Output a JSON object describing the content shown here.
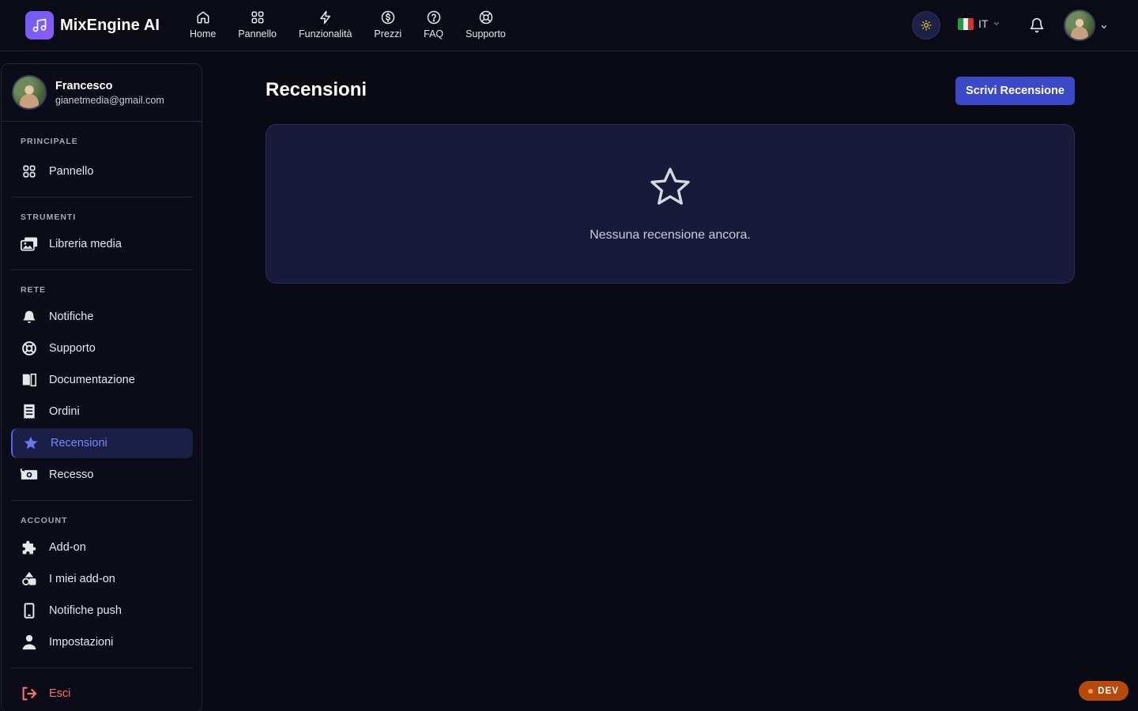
{
  "brand": {
    "name": "MixEngine AI",
    "icon": "music-note-icon",
    "accent": "#6d5cf6"
  },
  "nav": {
    "items": [
      {
        "label": "Home",
        "icon": "home-icon"
      },
      {
        "label": "Pannello",
        "icon": "grid-icon"
      },
      {
        "label": "Funzionalità",
        "icon": "bolt-icon"
      },
      {
        "label": "Prezzi",
        "icon": "dollar-icon"
      },
      {
        "label": "FAQ",
        "icon": "question-icon"
      },
      {
        "label": "Supporto",
        "icon": "lifebuoy-icon"
      }
    ]
  },
  "header": {
    "language": "IT",
    "theme_icon": "sun-icon",
    "notifications_icon": "bell-icon"
  },
  "profile": {
    "name": "Francesco",
    "email": "gianetmedia@gmail.com"
  },
  "sidebar": {
    "sections": [
      {
        "title": "PRINCIPALE",
        "items": [
          {
            "label": "Pannello",
            "icon": "grid-icon"
          }
        ]
      },
      {
        "title": "STRUMENTI",
        "items": [
          {
            "label": "Libreria media",
            "icon": "photos-icon"
          }
        ]
      },
      {
        "title": "RETE",
        "items": [
          {
            "label": "Notifiche",
            "icon": "bell-icon"
          },
          {
            "label": "Supporto",
            "icon": "lifebuoy-icon"
          },
          {
            "label": "Documentazione",
            "icon": "book-icon"
          },
          {
            "label": "Ordini",
            "icon": "receipt-icon"
          },
          {
            "label": "Recensioni",
            "icon": "star-icon",
            "active": true
          },
          {
            "label": "Recesso",
            "icon": "refund-icon"
          }
        ]
      },
      {
        "title": "ACCOUNT",
        "items": [
          {
            "label": "Add-on",
            "icon": "puzzle-icon"
          },
          {
            "label": "I miei add-on",
            "icon": "shapes-icon"
          },
          {
            "label": "Notifiche push",
            "icon": "mobile-icon"
          },
          {
            "label": "Impostazioni",
            "icon": "user-icon"
          }
        ]
      }
    ],
    "logout": {
      "label": "Esci",
      "icon": "logout-icon",
      "color": "#f87171"
    }
  },
  "main": {
    "title": "Recensioni",
    "write_button": "Scrivi Recensione",
    "empty_text": "Nessuna recensione ancora.",
    "empty_icon": "star-outline-icon"
  },
  "dev_badge": "DEV",
  "colors": {
    "background": "#0a0a14",
    "card": "#181a3a",
    "primary": "#3b48c8",
    "active_text": "#7b86ff",
    "dev_badge": "#b54a0c"
  }
}
